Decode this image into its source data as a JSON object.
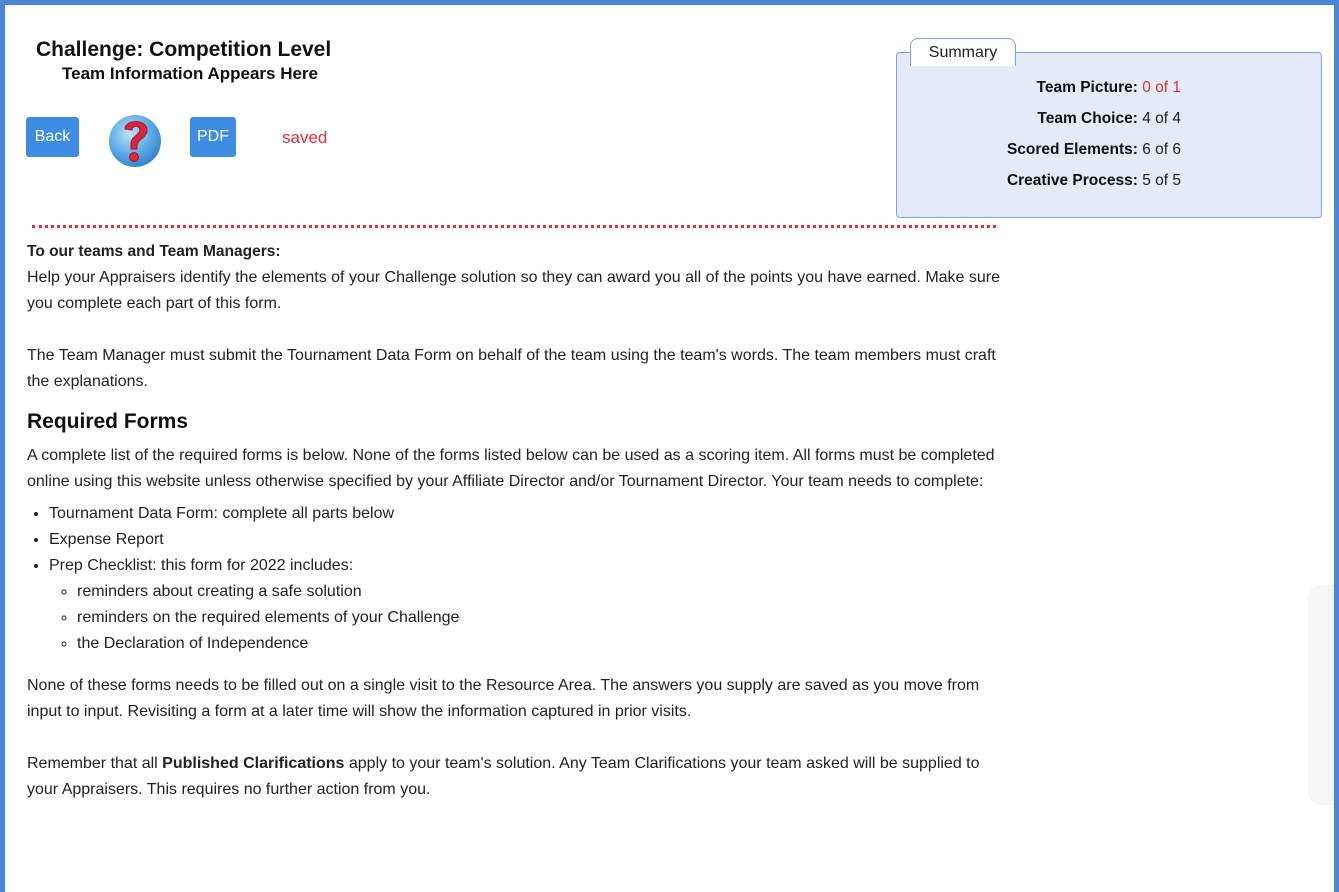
{
  "header": {
    "title": "Challenge: Competition Level",
    "subtitle": "Team Information Appears Here"
  },
  "toolbar": {
    "back_label": "Back",
    "help_icon": "question-mark-icon",
    "pdf_label": "PDF",
    "status_text": "saved"
  },
  "summary": {
    "tab_label": "Summary",
    "rows": [
      {
        "label": "Team Picture:",
        "value": "0 of 1",
        "color": "#d6313c"
      },
      {
        "label": "Team Choice:",
        "value": "4 of 4",
        "color": "#222222"
      },
      {
        "label": "Scored Elements:",
        "value": "6 of 6",
        "color": "#222222"
      },
      {
        "label": "Creative Process:",
        "value": "5 of 5",
        "color": "#222222"
      }
    ]
  },
  "content": {
    "lead": "To our teams and Team Managers:",
    "intro": "Help your Appraisers identify the elements of your Challenge solution so they can award you all of the points you have earned. Make sure you complete each part of this form.",
    "manager_note": "The Team Manager must submit the Tournament Data Form on behalf of the team using the team's words. The team members must craft the explanations.",
    "required_heading": "Required Forms",
    "required_text": "A complete list of the required forms is below. None of the forms listed below can be used as a scoring item. All forms must be completed online using this website unless otherwise specified by your Affiliate Director and/or Tournament Director. Your team needs to complete:",
    "list": {
      "item1": "Tournament Data Form: complete all parts below",
      "item2": "Expense Report",
      "item3": "Prep Checklist: this form for 2022 includes:",
      "sub1": "reminders about creating a safe solution",
      "sub2": "reminders on the required elements of your Challenge",
      "sub3": "the Declaration of Independence"
    },
    "visits_text": "None of these forms needs to be filled out on a single visit to the Resource Area. The answers you supply are saved as you move from input to input. Revisiting a form at a later time will show the information captured in prior visits.",
    "clar_pre": "Remember that all ",
    "clar_bold": "Published Clarifications",
    "clar_post": " apply to your team's solution. Any Team Clarifications your team asked will be supplied to your Appraisers. This requires no further action from you."
  }
}
